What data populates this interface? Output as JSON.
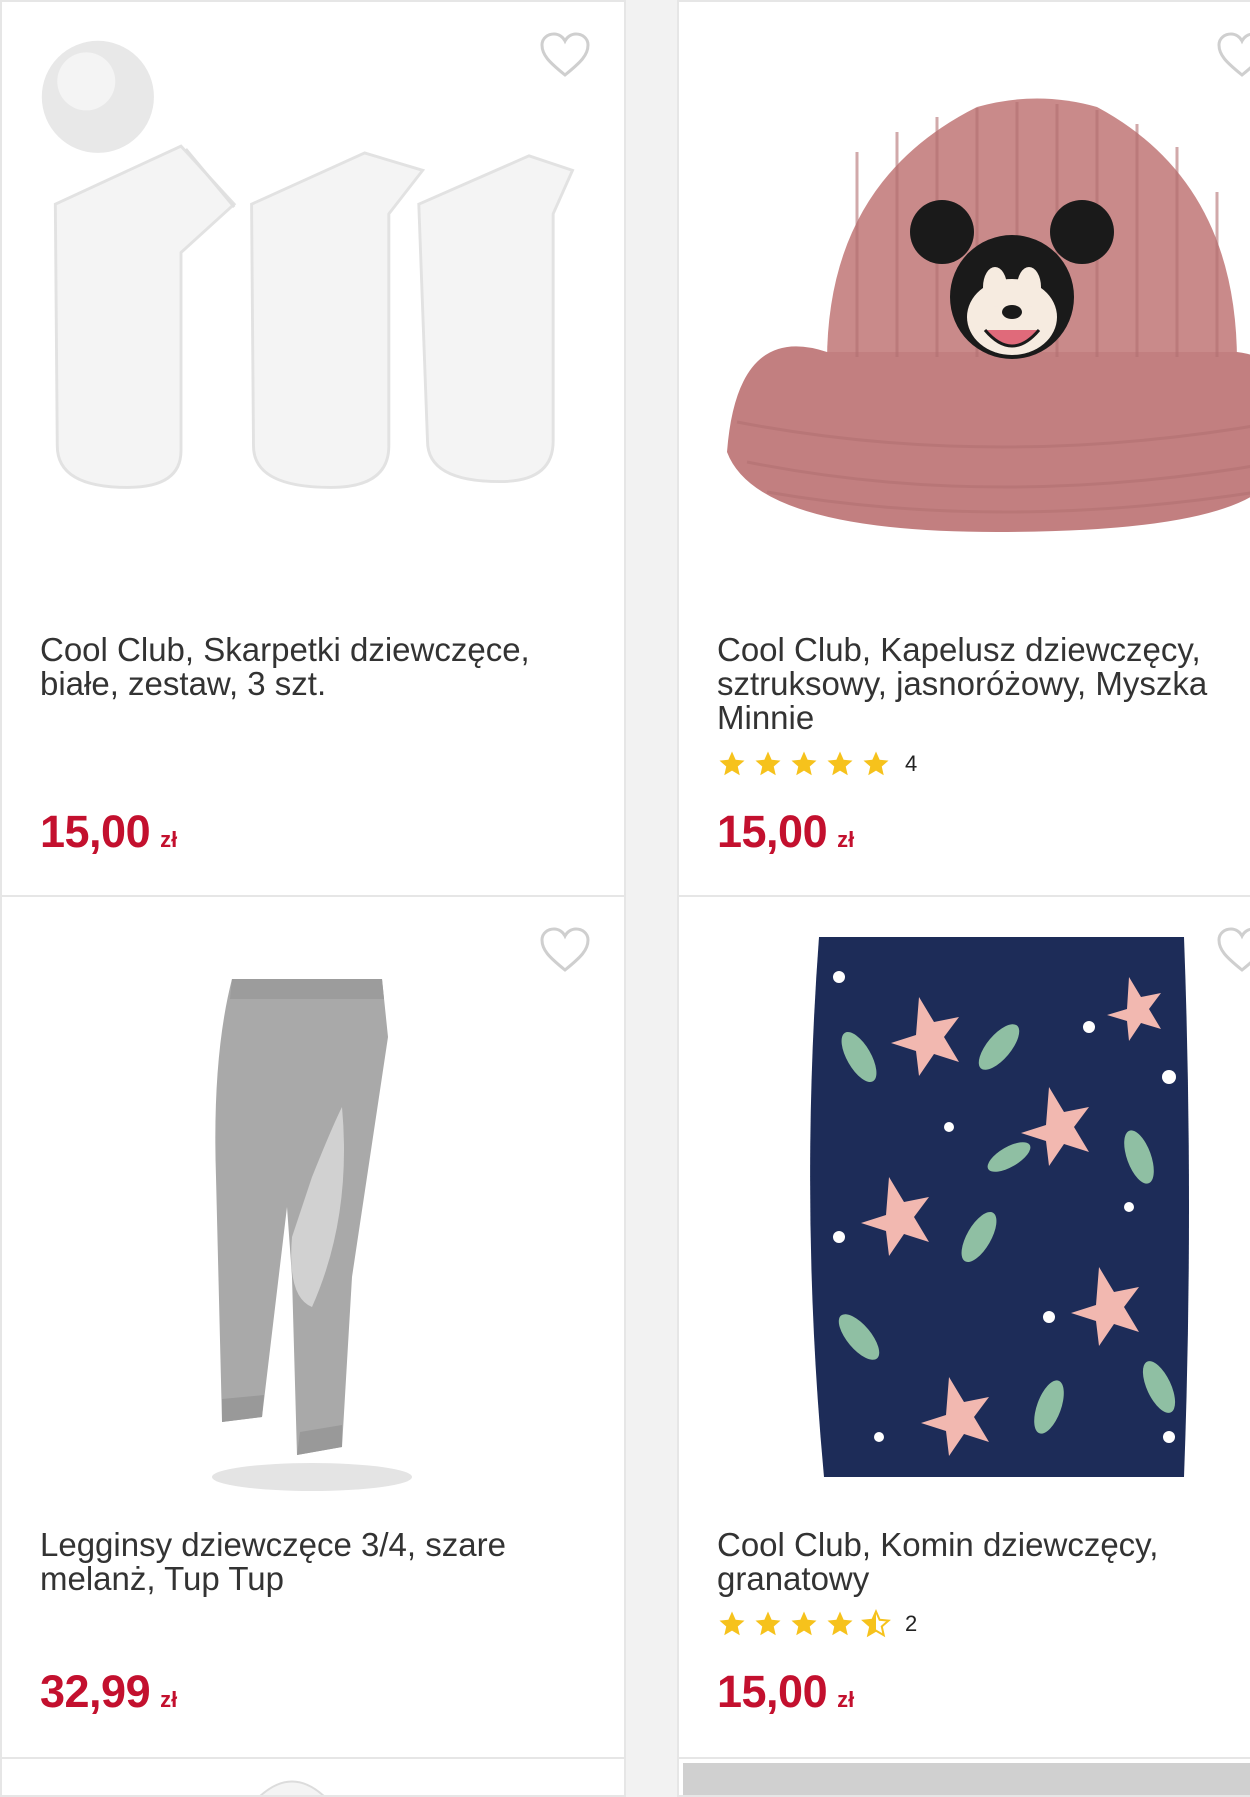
{
  "colors": {
    "price": "#c3102e",
    "star": "#f6c21c",
    "heart_outline": "#cfcfcf",
    "card_border": "#e6e6e6",
    "page_bg": "#f2f2f2"
  },
  "products": [
    {
      "title": "Cool Club, Skarpetki dziewczęce, białe, zestaw, 3 szt.",
      "price": "15,00",
      "currency": "zł",
      "image": "white-socks-set-image",
      "favorite_icon": "heart-outline-icon"
    },
    {
      "title": "Cool Club, Kapelusz dziewczęcy, sztruksowy, jasnoróżowy, Myszka Minnie",
      "price": "15,00",
      "currency": "zł",
      "rating": 5,
      "rating_count": "4",
      "image": "pink-corduroy-bucket-hat-image",
      "favorite_icon": "heart-outline-icon"
    },
    {
      "title": "Legginsy dziewczęce 3/4, szare melanż, Tup Tup",
      "price": "32,99",
      "currency": "zł",
      "image": "grey-leggings-image",
      "favorite_icon": "heart-outline-icon"
    },
    {
      "title": "Cool Club, Komin dziewczęcy, granatowy",
      "price": "15,00",
      "currency": "zł",
      "rating": 4.5,
      "rating_count": "2",
      "image": "navy-floral-neck-warmer-image",
      "favorite_icon": "heart-outline-icon"
    }
  ]
}
